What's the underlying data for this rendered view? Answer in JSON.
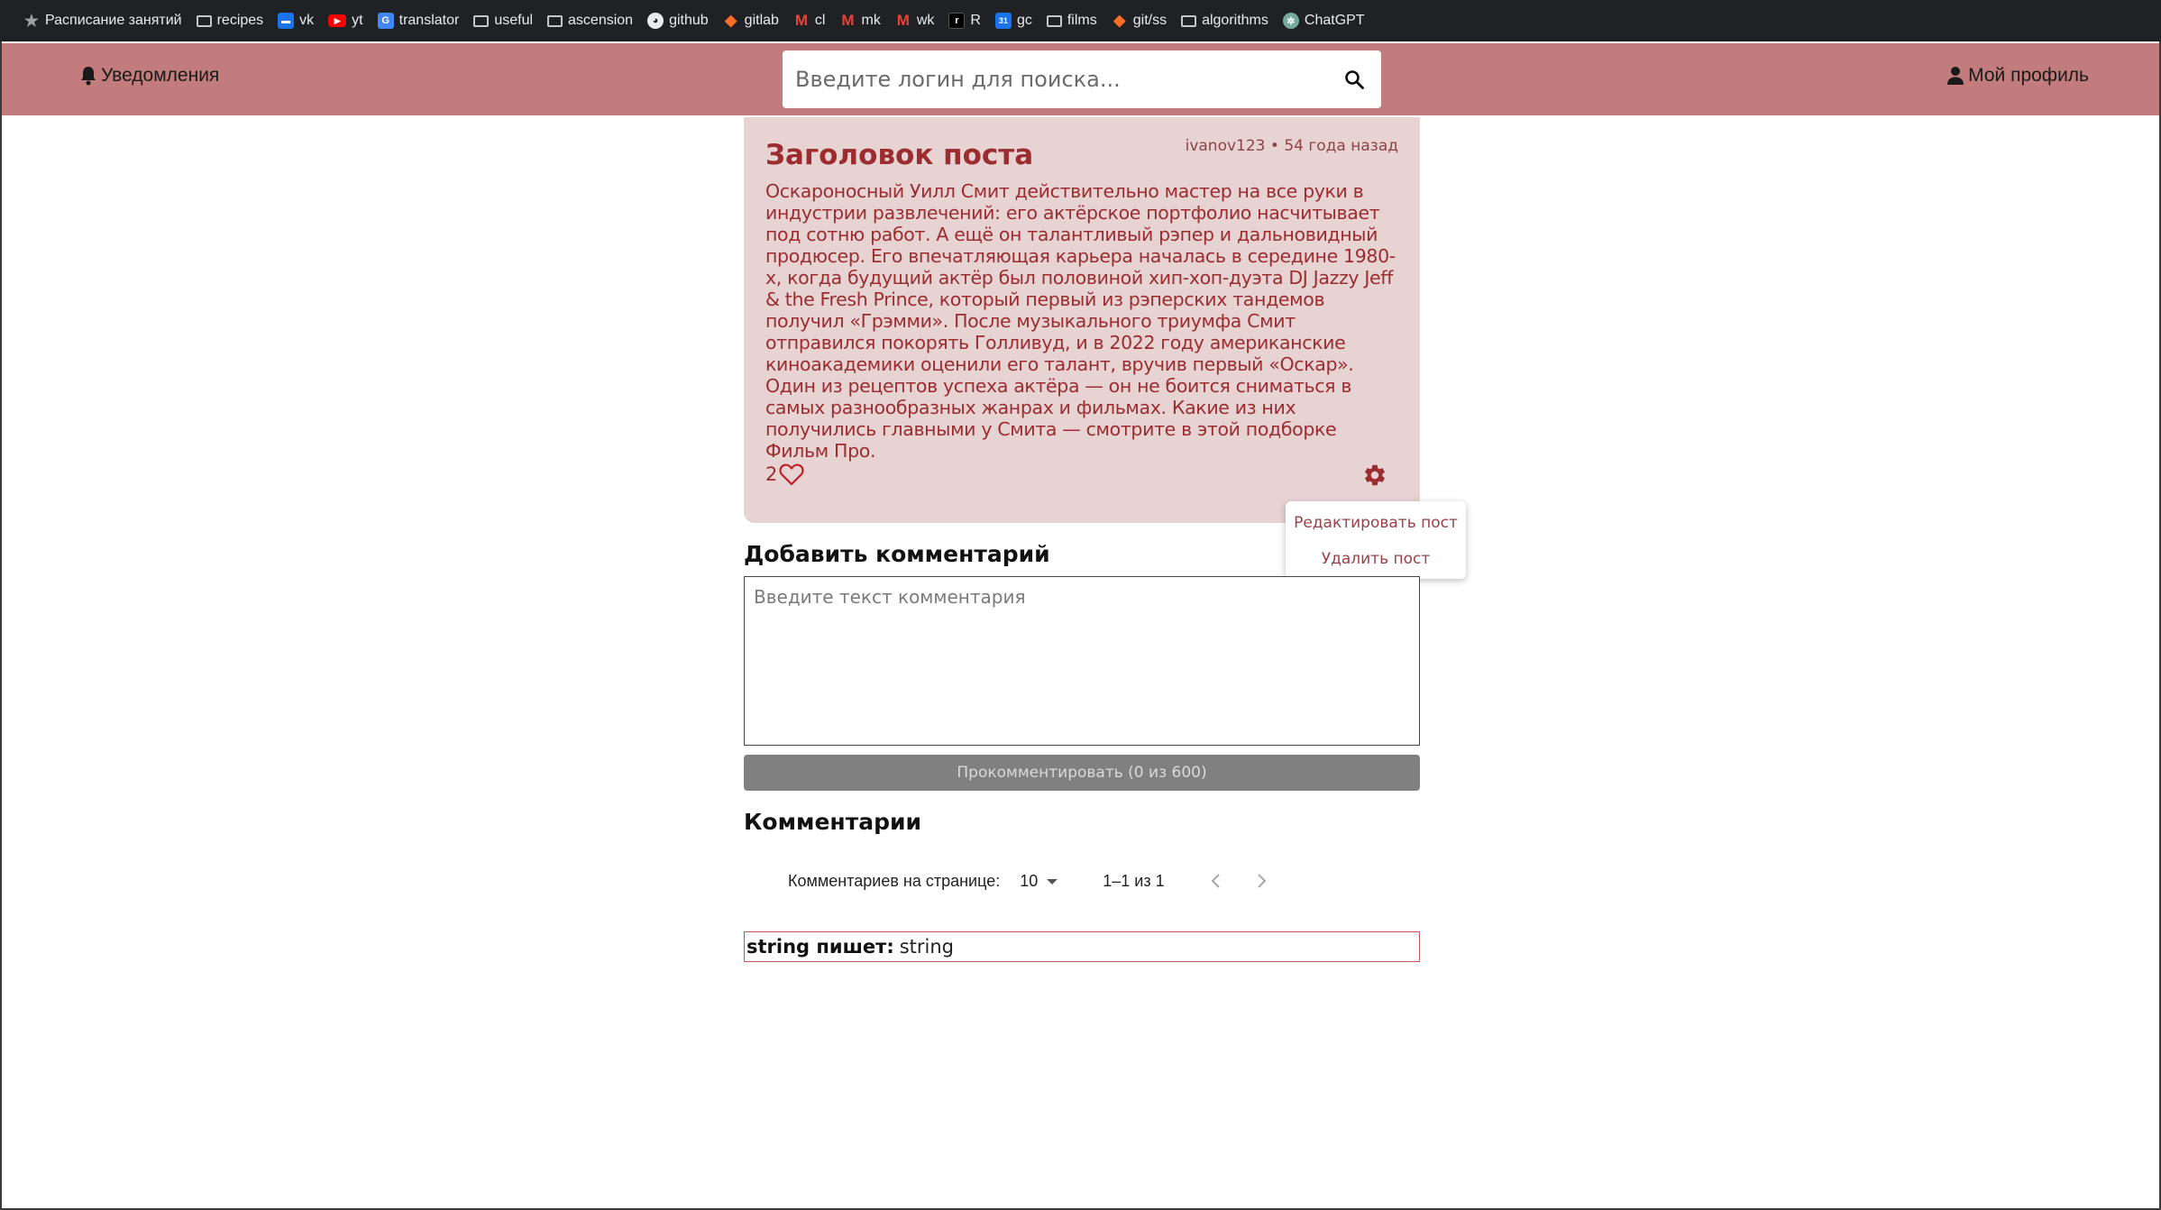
{
  "bookmarks": [
    {
      "label": "Расписание занятий",
      "icon": "star-icon"
    },
    {
      "label": "recipes",
      "icon": "folder-icon"
    },
    {
      "label": "vk",
      "icon": "vk-icon"
    },
    {
      "label": "yt",
      "icon": "youtube-icon"
    },
    {
      "label": "translator",
      "icon": "translate-icon"
    },
    {
      "label": "useful",
      "icon": "folder-icon"
    },
    {
      "label": "ascension",
      "icon": "folder-icon"
    },
    {
      "label": "github",
      "icon": "github-icon"
    },
    {
      "label": "gitlab",
      "icon": "gitlab-icon"
    },
    {
      "label": "cl",
      "icon": "gmail-icon"
    },
    {
      "label": "mk",
      "icon": "gmail-icon"
    },
    {
      "label": "wk",
      "icon": "gmail-icon"
    },
    {
      "label": "R",
      "icon": "r-icon"
    },
    {
      "label": "gc",
      "icon": "calendar-icon"
    },
    {
      "label": "films",
      "icon": "folder-icon"
    },
    {
      "label": "git/ss",
      "icon": "gitlab-icon"
    },
    {
      "label": "algorithms",
      "icon": "folder-icon"
    },
    {
      "label": "ChatGPT",
      "icon": "chatgpt-icon"
    }
  ],
  "header": {
    "notifications_label": "Уведомления",
    "search_placeholder": "Введите логин для поиска...",
    "profile_label": "Мой профиль",
    "bg_color": "#c27c7d"
  },
  "post": {
    "title": "Заголовок поста",
    "meta": "ivanov123 • 54 года назад",
    "body": "Оскароносный Уилл Смит действительно мастер на все руки в индустрии развлечений: его актёрское портфолио насчитывает под сотню работ. А ещё он талантливый рэпер и дальновидный продюсер. Его впечатляющая карьера началась в середине 1980-х, когда будущий актёр был половиной хип-хоп-дуэта DJ Jazzy Jeff & the Fresh Prince, который первый из рэперских тандемов получил «Грэмми». После музыкального триумфа Смит отправился покорять Голливуд, и в 2022 году американские киноакадемики оценили его талант, вручив первый «Оскар». Один из рецептов успеха актёра — он не боится сниматься в самых разнообразных жанрах и фильмах. Какие из них получились главными у Смита — смотрите в этой подборке Фильм Про.",
    "likes": "2",
    "accent_color": "#9b2c30",
    "card_color": "#e8d3d3"
  },
  "post_menu": {
    "edit_label": "Редактировать пост",
    "delete_label": "Удалить пост"
  },
  "add_comment": {
    "title": "Добавить комментарий",
    "placeholder": "Введите текст комментария",
    "submit_label": "Прокомментировать (0 из 600)"
  },
  "comments": {
    "title": "Комментарии",
    "per_page_label": "Комментариев на странице:",
    "per_page_value": "10",
    "range_label": "1–1 из 1",
    "items": [
      {
        "author": "string пишет:",
        "text": "string"
      }
    ]
  }
}
